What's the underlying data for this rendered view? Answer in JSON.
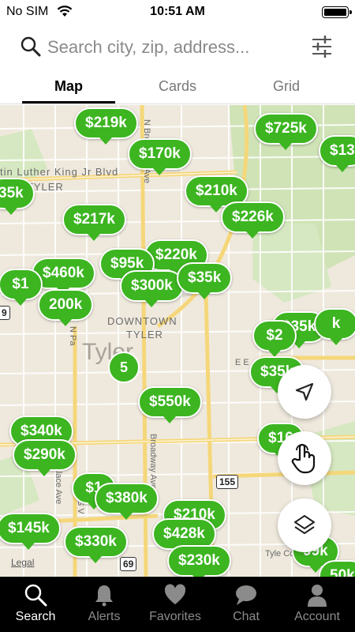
{
  "status": {
    "carrier": "No SIM",
    "time": "10:51 AM"
  },
  "search": {
    "placeholder": "Search city, zip, address..."
  },
  "tabs": [
    {
      "label": "Map",
      "active": true
    },
    {
      "label": "Cards",
      "active": false
    },
    {
      "label": "Grid",
      "active": false
    }
  ],
  "map": {
    "labels": {
      "mlk": "tin Luther King Jr Blvd",
      "north_tyler": "RTH TYLER",
      "downtown_1": "DOWNTOWN",
      "downtown_2": "TYLER",
      "city": "Tyler",
      "palace": "S Palace Ave",
      "broadway_n": "N Broadway Ave",
      "broadway_s": "Broadway Ave",
      "n_pa": "N Pa",
      "e_e": "E E",
      "s_v": "S V",
      "tyle_co": "Tyle Co"
    },
    "shields": {
      "hwy155": "155",
      "hwy69": "69",
      "left_9": "9"
    },
    "legal": "Legal",
    "cluster_count": "5",
    "prices": [
      "$219k",
      "$725k",
      "$13",
      "$170k",
      "35k",
      "$210k",
      "$226k",
      "$217k",
      "$220k",
      "$95k",
      "$460k",
      "$1",
      "$300k",
      "$35k",
      "200k",
      "$35k",
      "k",
      "$2",
      "$35k",
      "$550k",
      "$340k",
      "$290k",
      "$16",
      "$1",
      "$380k",
      "$210k",
      "$145k",
      "$428k",
      "$330k",
      "$230k",
      "99k",
      "50k"
    ],
    "accent_color": "#3cb520"
  },
  "fabs": {
    "locate_icon": "navigation-arrow-icon",
    "draw_icon": "hand-pointer-icon",
    "layers_icon": "layers-icon"
  },
  "nav": [
    {
      "label": "Search",
      "icon": "search-icon",
      "active": true
    },
    {
      "label": "Alerts",
      "icon": "bell-icon",
      "active": false
    },
    {
      "label": "Favorites",
      "icon": "heart-icon",
      "active": false
    },
    {
      "label": "Chat",
      "icon": "chat-bubble-icon",
      "active": false
    },
    {
      "label": "Account",
      "icon": "person-icon",
      "active": false
    }
  ]
}
